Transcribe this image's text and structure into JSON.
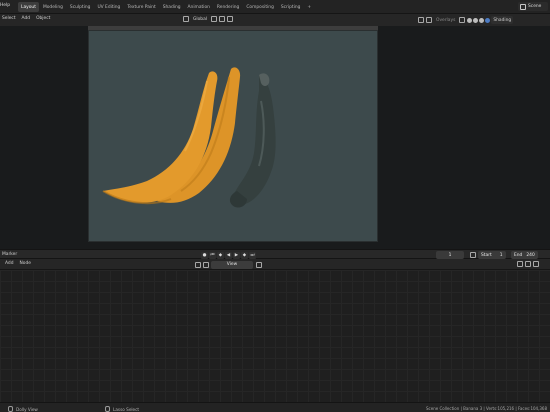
{
  "app": {
    "menu_label": "Help",
    "workspace_tabs": [
      "Layout",
      "Modeling",
      "Sculpting",
      "UV Editing",
      "Texture Paint",
      "Shading",
      "Animation",
      "Rendering",
      "Compositing",
      "Scripting"
    ],
    "active_tab": "Layout",
    "add_tab_label": "+",
    "scene_label": "Scene"
  },
  "viewport": {
    "left_menus": [
      "Select",
      "Add",
      "Object"
    ],
    "orientation_label": "Global",
    "overlay_label": "Overlays",
    "shading_label": "Shading",
    "background_color": "#3d4a4c",
    "banana_colors": {
      "yellow": "#e0962a",
      "dark": "#34403f"
    }
  },
  "timeline": {
    "menu_label": "Marker",
    "current_frame": "1",
    "start_label": "Start",
    "start_value": "1",
    "end_label": "End",
    "end_value": "240"
  },
  "node_editor": {
    "menus": [
      "Add",
      "Node"
    ],
    "view_field": "View"
  },
  "statusbar": {
    "left_hint": "Dolly View",
    "mid_hint": "Lasso Select",
    "stats": "Scene Collection | Banana 3 | Verts:105,216 | Faces:104,368"
  }
}
